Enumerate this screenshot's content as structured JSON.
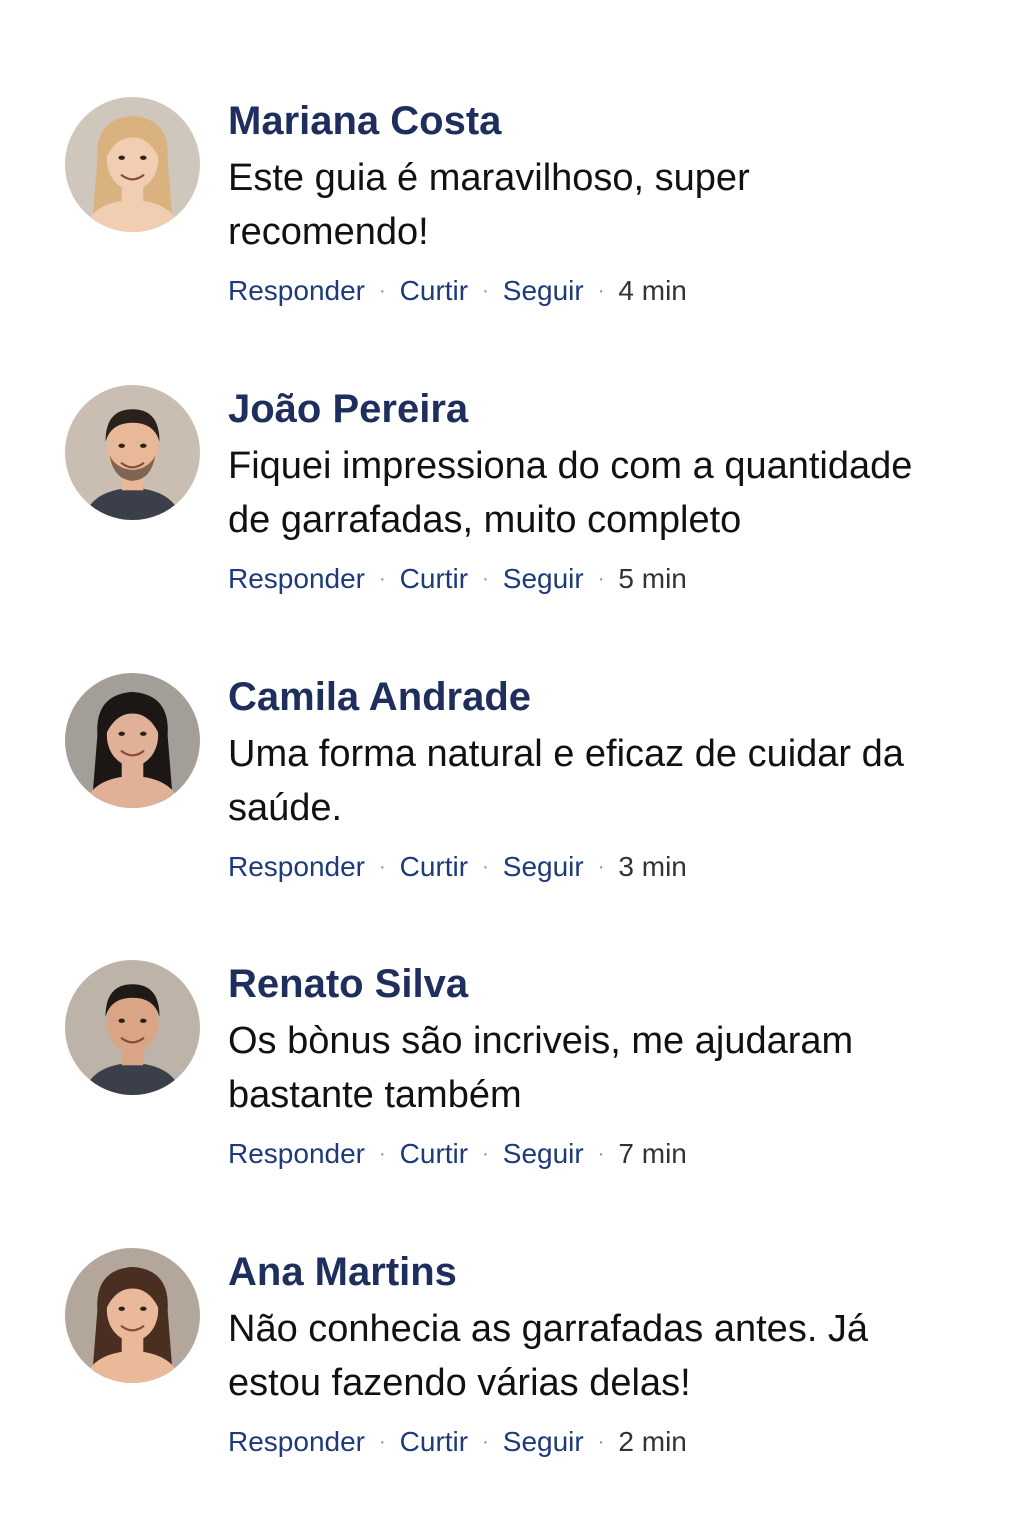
{
  "comments": [
    {
      "author": "Mariana Costa",
      "text": "Este guia é maravilhoso, super recomendo!",
      "reply": "Responder",
      "like": "Curtir",
      "follow": "Seguir",
      "time": "4 min",
      "avatar": {
        "bg": "#cfc6bc",
        "skin": "#f1cdb2",
        "hair": "#d9b27f"
      }
    },
    {
      "author": "João Pereira",
      "text": "Fiquei impressiona do com a quantidade de garrafadas, muito completo",
      "reply": "Responder",
      "like": "Curtir",
      "follow": "Seguir",
      "time": "5 min",
      "avatar": {
        "bg": "#cabeb3",
        "skin": "#e8b898",
        "hair": "#2a211c"
      }
    },
    {
      "author": "Camila Andrade",
      "text": "Uma forma natural e eficaz de cuidar da saúde.",
      "reply": "Responder",
      "like": "Curtir",
      "follow": "Seguir",
      "time": "3 min",
      "avatar": {
        "bg": "#a39e98",
        "skin": "#e0b196",
        "hair": "#1c1714"
      }
    },
    {
      "author": "Renato Silva",
      "text": "Os bònus são incriveis, me ajudaram bastante também",
      "reply": "Responder",
      "like": "Curtir",
      "follow": "Seguir",
      "time": "7 min",
      "avatar": {
        "bg": "#bdb3a8",
        "skin": "#d9a584",
        "hair": "#1f1a17"
      }
    },
    {
      "author": "Ana Martins",
      "text": "Não conhecia as garrafadas antes. Já estou fazendo várias delas!",
      "reply": "Responder",
      "like": "Curtir",
      "follow": "Seguir",
      "time": "2 min",
      "avatar": {
        "bg": "#b3a69a",
        "skin": "#e9b99a",
        "hair": "#4a2e22"
      }
    }
  ],
  "colors": {
    "author": "#1e2f5e",
    "link": "#1e3a7a",
    "text": "#111111",
    "background": "#ffffff"
  }
}
